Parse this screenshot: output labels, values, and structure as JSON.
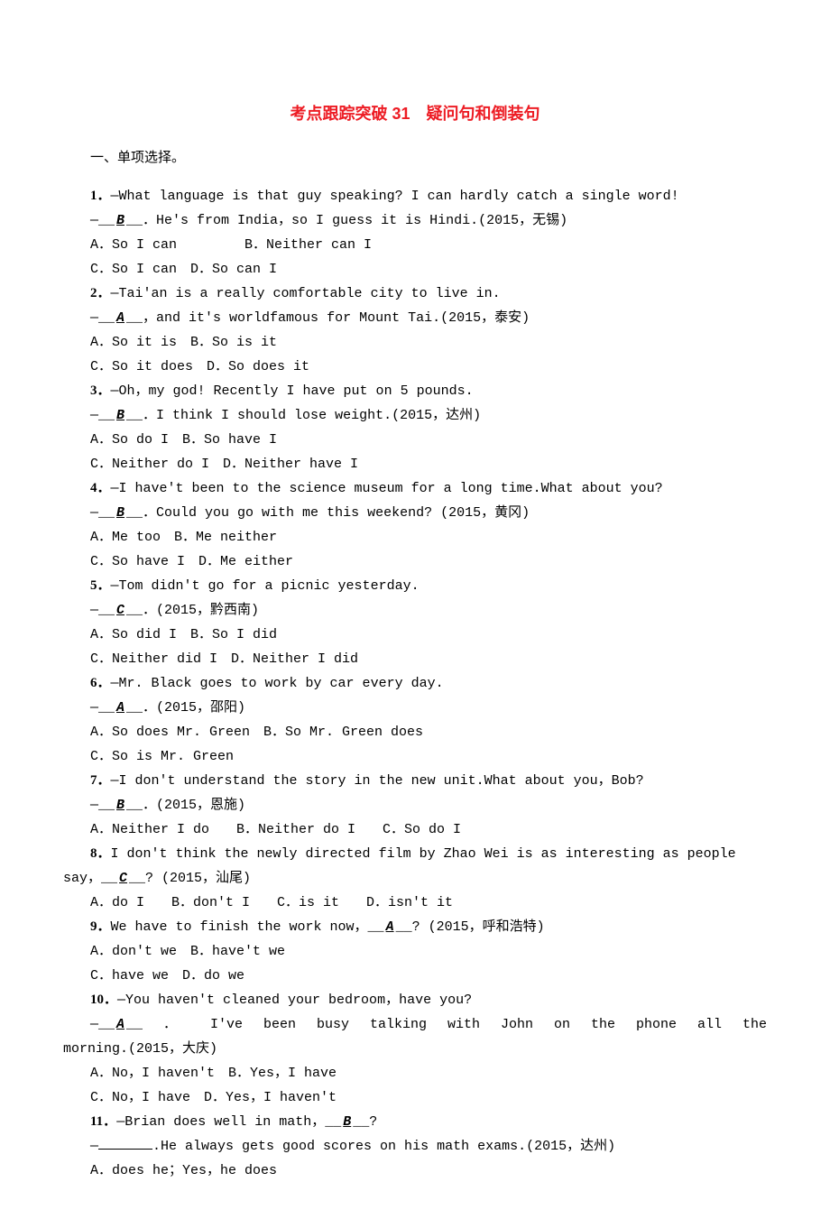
{
  "title": "考点跟踪突破 31　疑问句和倒装句",
  "sectionHead": "一、单项选择。",
  "q1": {
    "num": "1．",
    "line1": "—What language is that guy speaking? I can hardly catch a single word!",
    "dash": "—__",
    "ans": "B",
    "after": "__．He's from India，so I guess it is Hindi.(2015，无锡)",
    "opt1": "A．So I can　　　　　B．Neither can I",
    "opt2": "C．So I can　D．So can I"
  },
  "q2": {
    "num": "2．",
    "line1": "—Tai'an is a really comfortable city to live in.",
    "dash": "—__",
    "ans": "A",
    "after": "__，and it's world­famous for Mount Tai.(2015，泰安)",
    "opt1": "A．So it is　B．So is it",
    "opt2": "C．So it does　D．So does it"
  },
  "q3": {
    "num": "3．",
    "line1": "—Oh，my god! Recently I have put on 5 pounds.",
    "dash": "—__",
    "ans": "B",
    "after": "__．I think I should lose weight.(2015，达州)",
    "opt1": "A．So do I　B．So have I",
    "opt2": "C．Neither do I　D．Neither have I"
  },
  "q4": {
    "num": "4．",
    "line1": "—I have't been to the science museum for a long time.What about you?",
    "dash": "—__",
    "ans": "B",
    "after": "__．Could you go with me this weekend? (2015，黄冈)",
    "opt1": "A．Me too　B．Me neither",
    "opt2": "C．So have I　D．Me either"
  },
  "q5": {
    "num": "5．",
    "line1": "—Tom didn't go for a picnic yesterday.",
    "dash": "—__",
    "ans": "C",
    "after": "__．(2015，黔西南)",
    "opt1": "A．So did I　B．So I did",
    "opt2": "C．Neither did I　D．Neither I did"
  },
  "q6": {
    "num": "6．",
    "line1": "—Mr. Black goes to work by car every day.",
    "dash": "—__",
    "ans": "A",
    "after": "__．(2015，邵阳)",
    "opt1": "A．So does Mr. Green　B．So Mr. Green does",
    "opt2": "C．So is Mr. Green"
  },
  "q7": {
    "num": "7．",
    "line1": "—I don't understand the story in the new unit.What about you，Bob?",
    "dash": "—__",
    "ans": "B",
    "after": "__．(2015，恩施)",
    "opt1": "A．Neither I do　　B．Neither do I　　C．So do I"
  },
  "q8": {
    "num": "8．",
    "line1_pre": "I don't think the newly directed film by Zhao Wei is as interesting as people say，__",
    "ans": "C",
    "line1_post": "__? (2015，汕尾)",
    "opt1": "A．do I　　B．don't I　　C．is it　　D．isn't it"
  },
  "q9": {
    "num": "9．",
    "line1_pre": "We have to finish the work now，__",
    "ans": "A",
    "line1_post": "__? (2015，呼和浩特)",
    "opt1": "A．don't we　B．have't we",
    "opt2": "C．have we　D．do we"
  },
  "q10": {
    "num": "10．",
    "line1": "—You haven't cleaned your bedroom，have you?",
    "dash": "—__",
    "ans": "A",
    "after_a": "__ ． I've  been  busy  talking  with  John  on  the  phone  all  the",
    "after_b": "morning.(2015，大庆)",
    "opt1": "A．No，I haven't　B．Yes，I have",
    "opt2": "C．No，I have　D．Yes，I haven't"
  },
  "q11": {
    "num": "11．",
    "line1_pre": "—Brian does well in math，__",
    "ans": "B",
    "line1_post": "__?",
    "line2_pre": "—",
    "line2_post": ".He always gets good scores on his math exams.(2015，达州)",
    "opt1": "A．does he；Yes，he does"
  }
}
